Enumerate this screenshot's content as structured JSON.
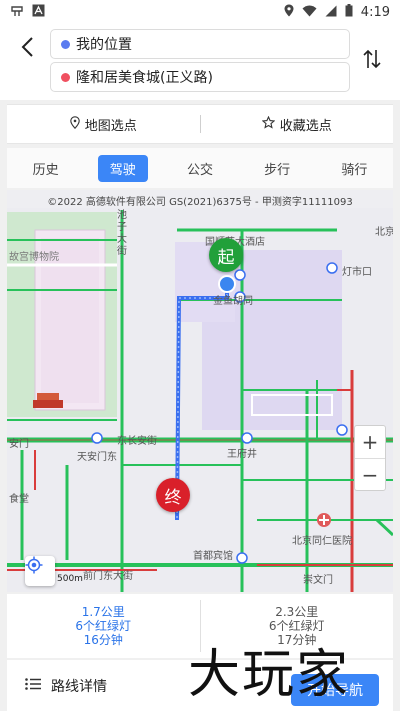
{
  "status_bar": {
    "time": "4:19",
    "icons": [
      "app-icon",
      "a-badge-icon",
      "location-icon",
      "wifi-icon",
      "signal-icon",
      "battery-icon"
    ]
  },
  "search": {
    "origin": "我的位置",
    "destination": "隆和居美食城(正义路)",
    "origin_dot_color": "#5b7cf0",
    "destination_dot_color": "#f05060"
  },
  "select_row": {
    "map_pick": "地图选点",
    "favorite_pick": "收藏选点"
  },
  "tabs": [
    {
      "label": "历史",
      "active": false
    },
    {
      "label": "驾驶",
      "active": true
    },
    {
      "label": "公交",
      "active": false
    },
    {
      "label": "步行",
      "active": false
    },
    {
      "label": "骑行",
      "active": false
    }
  ],
  "map": {
    "copyright": "©2022 高德软件有限公司 GS(2021)6375号 - 甲测资字11111093",
    "labels": {
      "palace_museum": "故宫博物院",
      "chi_street": "池子大街",
      "guoliyiyuan": "国顺苑大酒店",
      "dengshikou": "灯市口",
      "jinyu_hutong": "金鱼胡同",
      "east_changan": "东长安街",
      "tiananmen_east": "天安门东",
      "wangfujing": "王府井",
      "tongren": "北京同仁医院",
      "shoudu_hotel": "首都宾馆",
      "qianmen_east": "前门东大街",
      "chongwenmen": "崇文门",
      "beijing_label": "北京",
      "an_label": "安门",
      "shi_label": "食堂"
    },
    "start_marker": "起",
    "end_marker": "终",
    "scale": "500m",
    "zoom_in": "+",
    "zoom_out": "−"
  },
  "routes": [
    {
      "distance": "1.7公里",
      "lights": "6个红绿灯",
      "time": "16分钟",
      "selected": true
    },
    {
      "distance": "2.3公里",
      "lights": "6个红绿灯",
      "time": "17分钟",
      "selected": false
    }
  ],
  "bottom": {
    "details": "路线详情",
    "start_nav": "开始导航"
  },
  "watermark": "大玩家"
}
